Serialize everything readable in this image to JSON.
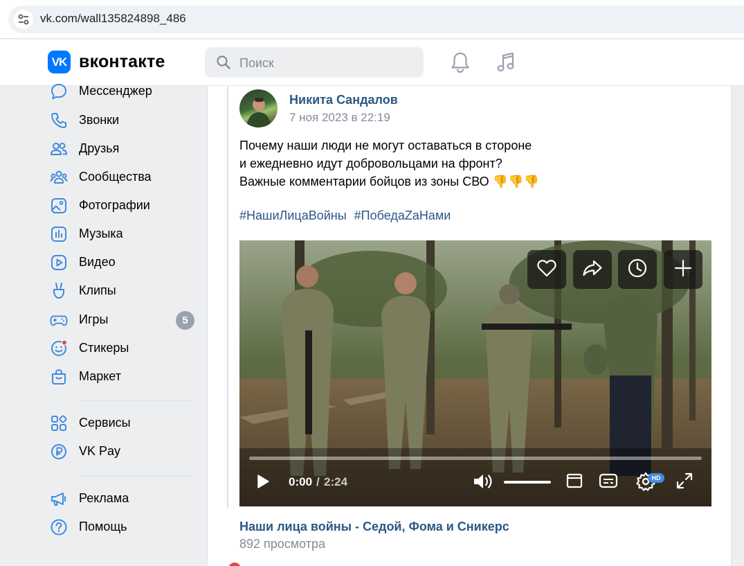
{
  "browser": {
    "url": "vk.com/wall135824898_486",
    "site_info_icon": "tune-icon"
  },
  "header": {
    "logo_text": "VK",
    "wordmark": "вконтакте",
    "search_placeholder": "Поиск",
    "accent_color": "#0077ff"
  },
  "sidebar": {
    "items": [
      {
        "label": "Мессенджер",
        "icon": "messenger-icon"
      },
      {
        "label": "Звонки",
        "icon": "phone-icon"
      },
      {
        "label": "Друзья",
        "icon": "friends-icon"
      },
      {
        "label": "Сообщества",
        "icon": "communities-icon"
      },
      {
        "label": "Фотографии",
        "icon": "photos-icon"
      },
      {
        "label": "Музыка",
        "icon": "music-icon"
      },
      {
        "label": "Видео",
        "icon": "video-icon"
      },
      {
        "label": "Клипы",
        "icon": "clips-icon"
      },
      {
        "label": "Игры",
        "icon": "games-icon",
        "badge": "5"
      },
      {
        "label": "Стикеры",
        "icon": "stickers-icon"
      },
      {
        "label": "Маркет",
        "icon": "market-icon"
      },
      {
        "label": "Сервисы",
        "icon": "services-icon"
      },
      {
        "label": "VK Pay",
        "icon": "vkpay-icon"
      },
      {
        "label": "Реклама",
        "icon": "ads-icon"
      },
      {
        "label": "Помощь",
        "icon": "help-icon"
      }
    ]
  },
  "post": {
    "author": "Никита Сандалов",
    "date": "7 ноя 2023 в 22:19",
    "text_lines": [
      "Почему наши люди не могут оставаться в стороне",
      "и ежедневно идут добровольцами на фронт?",
      "Важные комментарии бойцов из зоны СВО 👎👎👎"
    ],
    "hashtags": [
      "#НашиЛицаВойны",
      "#ПобедаZaНами"
    ],
    "video": {
      "current_time": "0:00",
      "separator": "/",
      "duration": "2:24",
      "progress": 0,
      "volume": 1.0,
      "hd_label": "HD",
      "title": "Наши лица войны - Седой, Фома и Сникерс",
      "views": "892 просмотра"
    }
  }
}
